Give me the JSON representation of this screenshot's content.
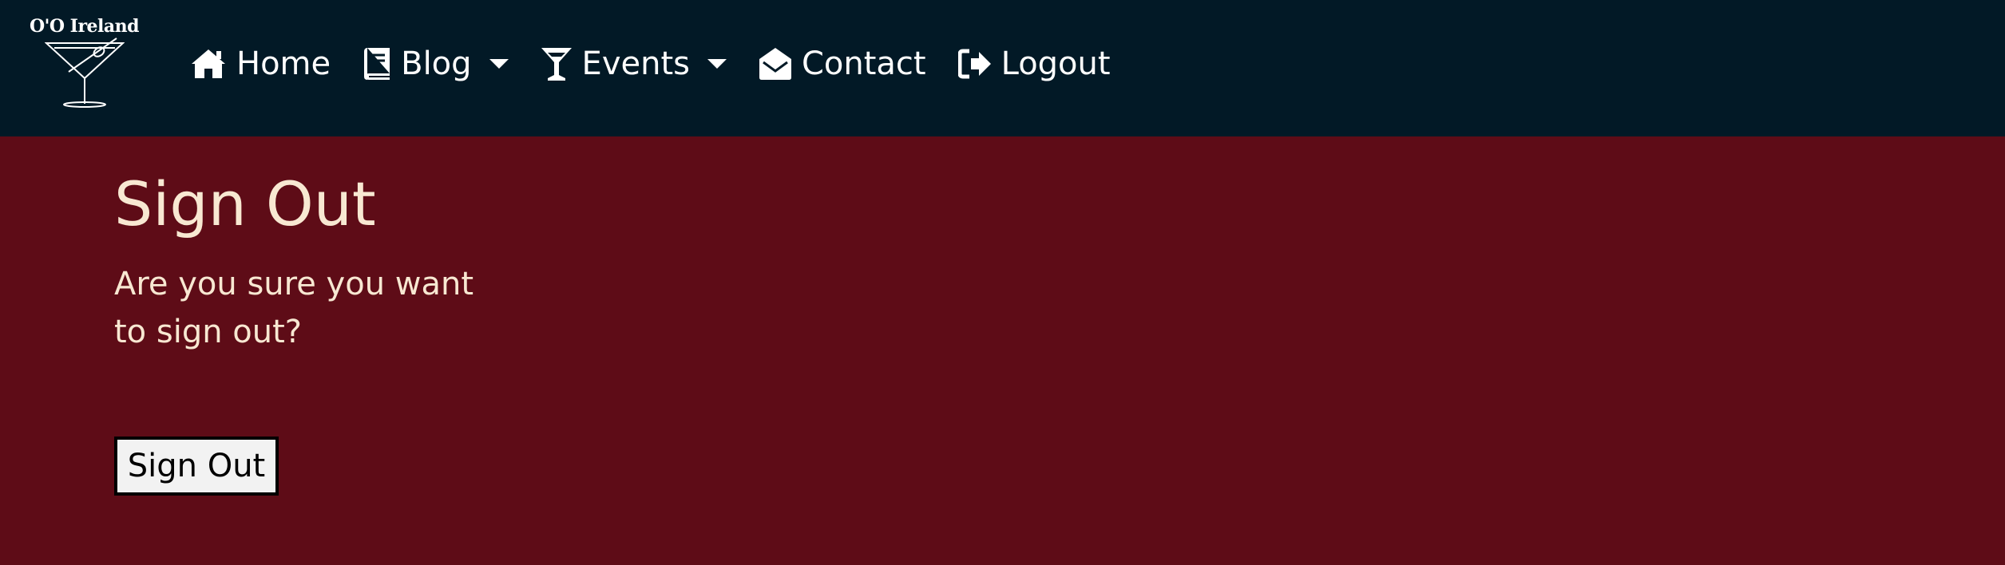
{
  "brand": {
    "name": "O'O Ireland"
  },
  "nav": {
    "items": [
      {
        "label": "Home",
        "icon": "home-icon"
      },
      {
        "label": "Blog",
        "icon": "book-icon",
        "dropdown": true
      },
      {
        "label": "Events",
        "icon": "cocktail-icon",
        "dropdown": true
      },
      {
        "label": "Contact",
        "icon": "envelope-open-icon"
      },
      {
        "label": "Logout",
        "icon": "sign-out-icon"
      }
    ]
  },
  "main": {
    "title": "Sign Out",
    "question": "Are you sure you want to sign out?",
    "button_label": "Sign Out"
  },
  "colors": {
    "navbar_bg": "#021926",
    "page_bg": "#5e0c17",
    "heading_text": "#f8e8d2",
    "nav_text": "#ffffff",
    "button_bg": "#f2f2f2"
  }
}
